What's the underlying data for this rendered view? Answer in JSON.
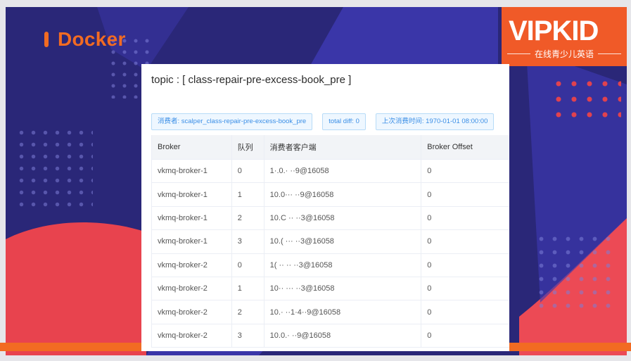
{
  "slide": {
    "title": "Docker",
    "logo_text": "VIPKID",
    "logo_subtitle": "在线青少儿英语"
  },
  "panel": {
    "topic": "topic : [ class-repair-pre-excess-book_pre ]",
    "tags": [
      "消费者: scalper_class-repair-pre-excess-book_pre",
      "total diff: 0",
      "上次消费时间: 1970-01-01 08:00:00"
    ],
    "columns": [
      "Broker",
      "队列",
      "消费者客户端",
      "Broker Offset"
    ],
    "rows": [
      [
        "vkmq-broker-1",
        "0",
        "1·.0.· ··9@16058",
        "0"
      ],
      [
        "vkmq-broker-1",
        "1",
        "10.0··· ··9@16058",
        "0"
      ],
      [
        "vkmq-broker-1",
        "2",
        "10.C ·· ··3@16058",
        "0"
      ],
      [
        "vkmq-broker-1",
        "3",
        "10.( ··· ··3@16058",
        "0"
      ],
      [
        "vkmq-broker-2",
        "0",
        "1( ·· ·· ··3@16058",
        "0"
      ],
      [
        "vkmq-broker-2",
        "1",
        "10·· ··· ··3@16058",
        "0"
      ],
      [
        "vkmq-broker-2",
        "2",
        "10.· ··1·4··9@16058",
        "0"
      ],
      [
        "vkmq-broker-2",
        "3",
        "10.0.· ··9@16058",
        "0"
      ]
    ]
  },
  "colors": {
    "slide_bg": "#2a2778",
    "accent_orange": "#f26b22",
    "logo_bg": "#f05a28",
    "tag_blue": "#3a8ee6",
    "coral": "#ec4a55"
  }
}
